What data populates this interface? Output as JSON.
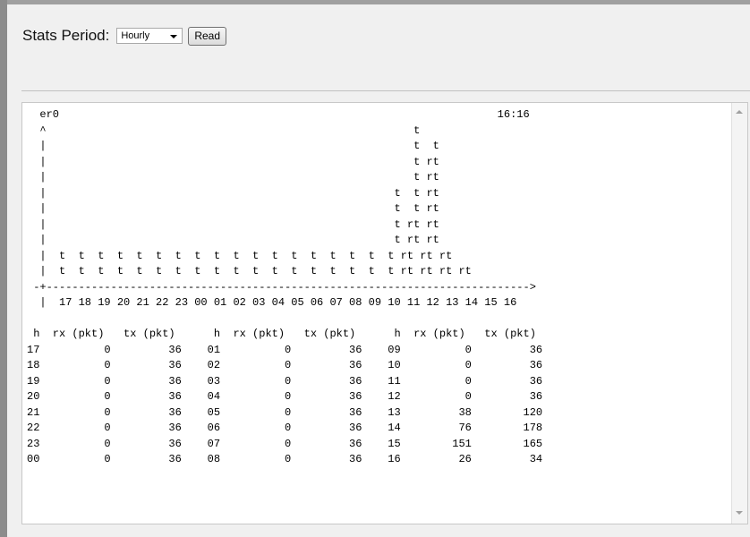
{
  "toolbar": {
    "period_label": "Stats Period:",
    "period_value": "Hourly",
    "read_button": "Read"
  },
  "output": {
    "text": "  er0                                                                    16:16\n  ^                                                         t\n  |                                                         t  t\n  |                                                         t rt\n  |                                                         t rt\n  |                                                      t  t rt\n  |                                                      t  t rt\n  |                                                      t rt rt\n  |                                                      t rt rt\n  |  t  t  t  t  t  t  t  t  t  t  t  t  t  t  t  t  t  t rt rt rt\n  |  t  t  t  t  t  t  t  t  t  t  t  t  t  t  t  t  t  t rt rt rt rt\n -+--------------------------------------------------------------------------->\n  |  17 18 19 20 21 22 23 00 01 02 03 04 05 06 07 08 09 10 11 12 13 14 15 16\n\n h  rx (pkt)   tx (pkt)      h  rx (pkt)   tx (pkt)      h  rx (pkt)   tx (pkt)\n17          0         36    01          0         36    09          0         36\n18          0         36    02          0         36    10          0         36\n19          0         36    03          0         36    11          0         36\n20          0         36    04          0         36    12          0         36\n21          0         36    05          0         36    13         38        120\n22          0         36    06          0         36    14         76        178\n23          0         36    07          0         36    15        151        165\n00          0         36    08          0         36    16         26         34"
  }
}
